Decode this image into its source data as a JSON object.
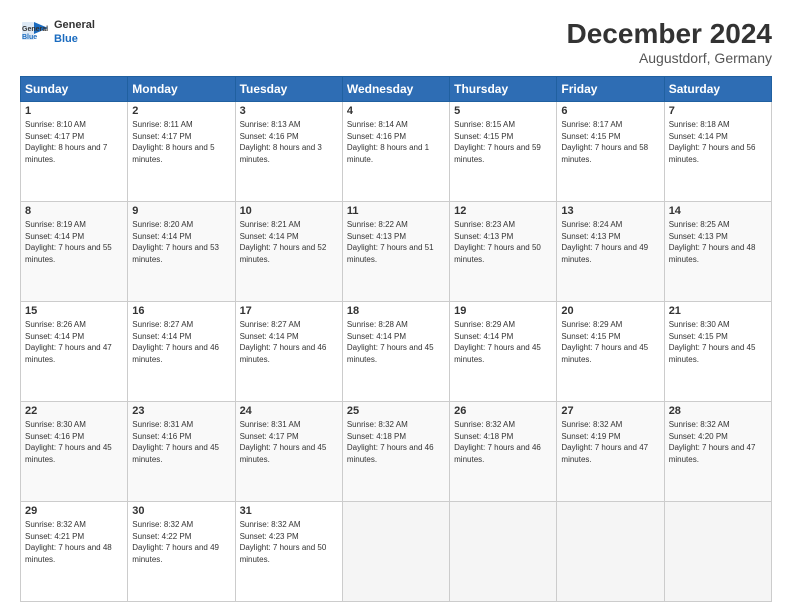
{
  "header": {
    "logo_line1": "General",
    "logo_line2": "Blue",
    "month": "December 2024",
    "location": "Augustdorf, Germany"
  },
  "days_of_week": [
    "Sunday",
    "Monday",
    "Tuesday",
    "Wednesday",
    "Thursday",
    "Friday",
    "Saturday"
  ],
  "weeks": [
    [
      {
        "day": "1",
        "sunrise": "8:10 AM",
        "sunset": "4:17 PM",
        "daylight": "8 hours and 7 minutes."
      },
      {
        "day": "2",
        "sunrise": "8:11 AM",
        "sunset": "4:17 PM",
        "daylight": "8 hours and 5 minutes."
      },
      {
        "day": "3",
        "sunrise": "8:13 AM",
        "sunset": "4:16 PM",
        "daylight": "8 hours and 3 minutes."
      },
      {
        "day": "4",
        "sunrise": "8:14 AM",
        "sunset": "4:16 PM",
        "daylight": "8 hours and 1 minute."
      },
      {
        "day": "5",
        "sunrise": "8:15 AM",
        "sunset": "4:15 PM",
        "daylight": "7 hours and 59 minutes."
      },
      {
        "day": "6",
        "sunrise": "8:17 AM",
        "sunset": "4:15 PM",
        "daylight": "7 hours and 58 minutes."
      },
      {
        "day": "7",
        "sunrise": "8:18 AM",
        "sunset": "4:14 PM",
        "daylight": "7 hours and 56 minutes."
      }
    ],
    [
      {
        "day": "8",
        "sunrise": "8:19 AM",
        "sunset": "4:14 PM",
        "daylight": "7 hours and 55 minutes."
      },
      {
        "day": "9",
        "sunrise": "8:20 AM",
        "sunset": "4:14 PM",
        "daylight": "7 hours and 53 minutes."
      },
      {
        "day": "10",
        "sunrise": "8:21 AM",
        "sunset": "4:14 PM",
        "daylight": "7 hours and 52 minutes."
      },
      {
        "day": "11",
        "sunrise": "8:22 AM",
        "sunset": "4:13 PM",
        "daylight": "7 hours and 51 minutes."
      },
      {
        "day": "12",
        "sunrise": "8:23 AM",
        "sunset": "4:13 PM",
        "daylight": "7 hours and 50 minutes."
      },
      {
        "day": "13",
        "sunrise": "8:24 AM",
        "sunset": "4:13 PM",
        "daylight": "7 hours and 49 minutes."
      },
      {
        "day": "14",
        "sunrise": "8:25 AM",
        "sunset": "4:13 PM",
        "daylight": "7 hours and 48 minutes."
      }
    ],
    [
      {
        "day": "15",
        "sunrise": "8:26 AM",
        "sunset": "4:14 PM",
        "daylight": "7 hours and 47 minutes."
      },
      {
        "day": "16",
        "sunrise": "8:27 AM",
        "sunset": "4:14 PM",
        "daylight": "7 hours and 46 minutes."
      },
      {
        "day": "17",
        "sunrise": "8:27 AM",
        "sunset": "4:14 PM",
        "daylight": "7 hours and 46 minutes."
      },
      {
        "day": "18",
        "sunrise": "8:28 AM",
        "sunset": "4:14 PM",
        "daylight": "7 hours and 45 minutes."
      },
      {
        "day": "19",
        "sunrise": "8:29 AM",
        "sunset": "4:14 PM",
        "daylight": "7 hours and 45 minutes."
      },
      {
        "day": "20",
        "sunrise": "8:29 AM",
        "sunset": "4:15 PM",
        "daylight": "7 hours and 45 minutes."
      },
      {
        "day": "21",
        "sunrise": "8:30 AM",
        "sunset": "4:15 PM",
        "daylight": "7 hours and 45 minutes."
      }
    ],
    [
      {
        "day": "22",
        "sunrise": "8:30 AM",
        "sunset": "4:16 PM",
        "daylight": "7 hours and 45 minutes."
      },
      {
        "day": "23",
        "sunrise": "8:31 AM",
        "sunset": "4:16 PM",
        "daylight": "7 hours and 45 minutes."
      },
      {
        "day": "24",
        "sunrise": "8:31 AM",
        "sunset": "4:17 PM",
        "daylight": "7 hours and 45 minutes."
      },
      {
        "day": "25",
        "sunrise": "8:32 AM",
        "sunset": "4:18 PM",
        "daylight": "7 hours and 46 minutes."
      },
      {
        "day": "26",
        "sunrise": "8:32 AM",
        "sunset": "4:18 PM",
        "daylight": "7 hours and 46 minutes."
      },
      {
        "day": "27",
        "sunrise": "8:32 AM",
        "sunset": "4:19 PM",
        "daylight": "7 hours and 47 minutes."
      },
      {
        "day": "28",
        "sunrise": "8:32 AM",
        "sunset": "4:20 PM",
        "daylight": "7 hours and 47 minutes."
      }
    ],
    [
      {
        "day": "29",
        "sunrise": "8:32 AM",
        "sunset": "4:21 PM",
        "daylight": "7 hours and 48 minutes."
      },
      {
        "day": "30",
        "sunrise": "8:32 AM",
        "sunset": "4:22 PM",
        "daylight": "7 hours and 49 minutes."
      },
      {
        "day": "31",
        "sunrise": "8:32 AM",
        "sunset": "4:23 PM",
        "daylight": "7 hours and 50 minutes."
      },
      null,
      null,
      null,
      null
    ]
  ]
}
